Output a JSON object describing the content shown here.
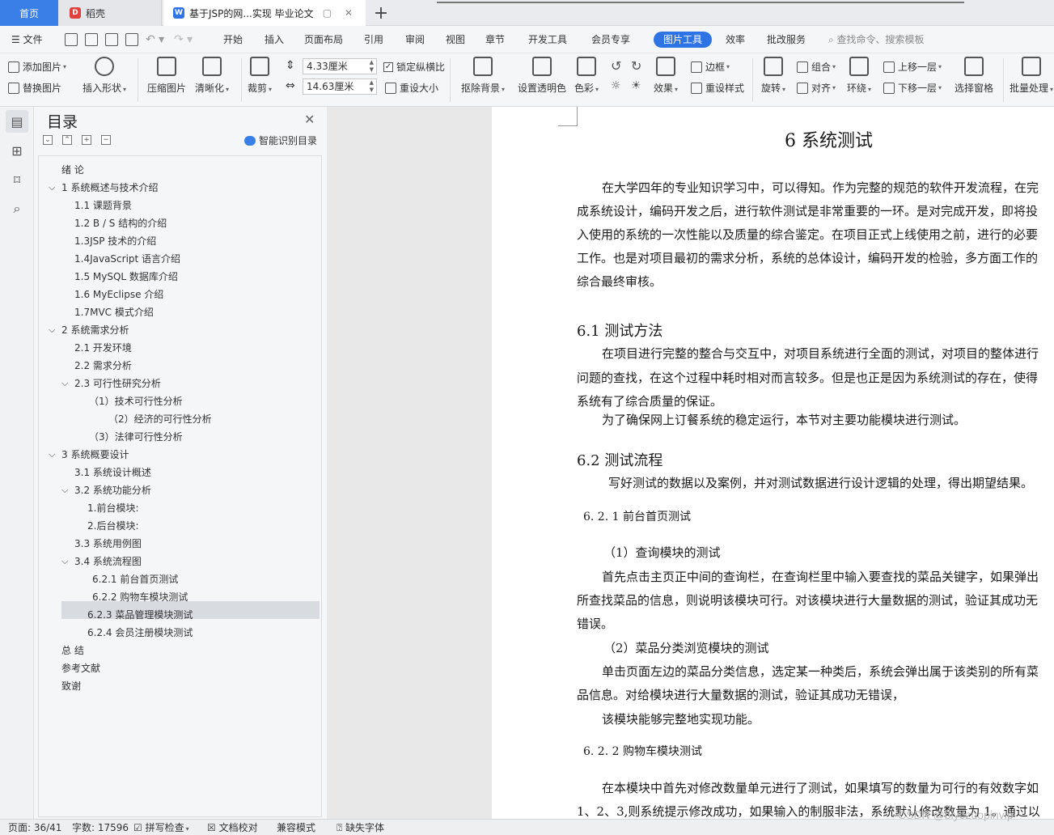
{
  "titlebar": {
    "home_tab": "首页",
    "dk_tab": "稻壳",
    "doc_tab": "基于JSP的网...实现 毕业论文",
    "add_tab": "+"
  },
  "menubar": {
    "file": "文件",
    "items": [
      "开始",
      "插入",
      "页面布局",
      "引用",
      "审阅",
      "视图",
      "章节",
      "开发工具",
      "会员专享",
      "图片工具",
      "效率",
      "批改服务"
    ],
    "search": "查找命令、搜索模板"
  },
  "ribbon": {
    "add_image": "添加图片",
    "replace_image": "替换图片",
    "insert_shape": "插入形状",
    "compress": "压缩图片",
    "sharpen": "清晰化",
    "crop": "裁剪",
    "height": "4.33厘米",
    "width": "14.63厘米",
    "lock_ratio": "锁定纵横比",
    "reset_size": "重设大小",
    "remove_bg": "抠除背景",
    "set_transparent": "设置透明色",
    "color": "色彩",
    "effects": "效果",
    "border": "边框",
    "reset_style": "重设样式",
    "rotate": "旋转",
    "group": "组合",
    "align": "对齐",
    "wrap": "环绕",
    "bring_forward": "上移一层",
    "send_backward": "下移一层",
    "selection_pane": "选择窗格",
    "batch": "批量处理"
  },
  "toc": {
    "title": "目录",
    "smart": "智能识别目录",
    "items": [
      "绪   论",
      "1    系统概述与技术介绍",
      "1.1   课题背景",
      "1.2 B / S 结构的介绍",
      "1.3JSP 技术的介绍",
      "1.4JavaScript 语言介绍",
      "1.5    MySQL 数据库介绍",
      "1.6    MyEclipse 介绍",
      "1.7MVC 模式介绍",
      "2    系统需求分析",
      "2.1    开发环境",
      "2.2    需求分析",
      "2.3    可行性研究分析",
      "（1）技术可行性分析",
      "（2）经济的可行性分析",
      "（3）法律可行性分析",
      "3    系统概要设计",
      "3.1    系统设计概述",
      "3.2    系统功能分析",
      "1.前台模块:",
      "2.后台模块:",
      "3.3    系统用例图",
      "3.4    系统流程图",
      "6.2.1 前台首页测试",
      "6.2.2 购物车模块测试",
      "6.2.3 菜品管理模块测试",
      "6.2.4 会员注册模块测试",
      "总  结",
      "参考文献",
      "致谢"
    ]
  },
  "document": {
    "chapter_title": "6    系统测试",
    "p1": [
      "在大学四年的专业知识学习中，可以得知。作为完整的规范的软件开发流程，在完",
      "成系统设计，编码开发之后，进行软件测试是非常重要的一环。是对完成开发，即将投",
      "入使用的系统的一次性能以及质量的综合鉴定。在项目正式上线使用之前，进行的必要",
      "工作。也是对项目最初的需求分析，系统的总体设计，编码开发的检验，多方面工作的",
      "综合最终审核。"
    ],
    "s61": "6.1    测试方法",
    "p2": [
      "在项目进行完整的整合与交互中，对项目系统进行全面的测试，对项目的整体进行",
      "问题的查找，在这个过程中耗时相对而言较多。但是也正是因为系统测试的存在，使得",
      "系统有了综合质量的保证。",
      "为了确保网上订餐系统的稳定运行，本节对主要功能模块进行测试。"
    ],
    "s62": "6.2    测试流程",
    "p3": "写好测试的数据以及案例，并对测试数据进行设计逻辑的处理，得出期望结果。",
    "s621": "6. 2. 1 前台首页测试",
    "q1": "（1）查询模块的测试",
    "p4": [
      "首先点击主页正中间的查询栏，在查询栏里中输入要查找的菜品关键字，如果弹出",
      "所查找菜品的信息，则说明该模块可行。对该模块进行大量数据的测试，验证其成功无",
      "错误。"
    ],
    "q2": "（2）菜品分类浏览模块的测试",
    "p5": [
      "单击页面左边的菜品分类信息，选定某一种类后，系统会弹出属于该类别的所有菜",
      "品信息。对给模块进行大量数据的测试，验证其成功无错误，",
      "该模块能够完整地实现功能。"
    ],
    "s622": "6. 2. 2 购物车模块测试",
    "p6": [
      "在本模块中首先对修改数量单元进行了测试，如果填写的数量为可行的有效数字如",
      "1、2、3,则系统提示修改成功，如果输入的制服非法，系统默认修改数量为 1。通过以"
    ]
  },
  "statusbar": {
    "page": "页面: 36/41",
    "words": "字数: 17596",
    "spell": "拼写检查",
    "proof": "文档校对",
    "compat": "兼容模式",
    "missing_font": "缺失字体"
  },
  "watermark": "CSDN @biyezuopinvip",
  "colors": {
    "accent": "#3a7ee8",
    "active_tool": "#2f74e5",
    "selection": "#d8dbe0"
  }
}
